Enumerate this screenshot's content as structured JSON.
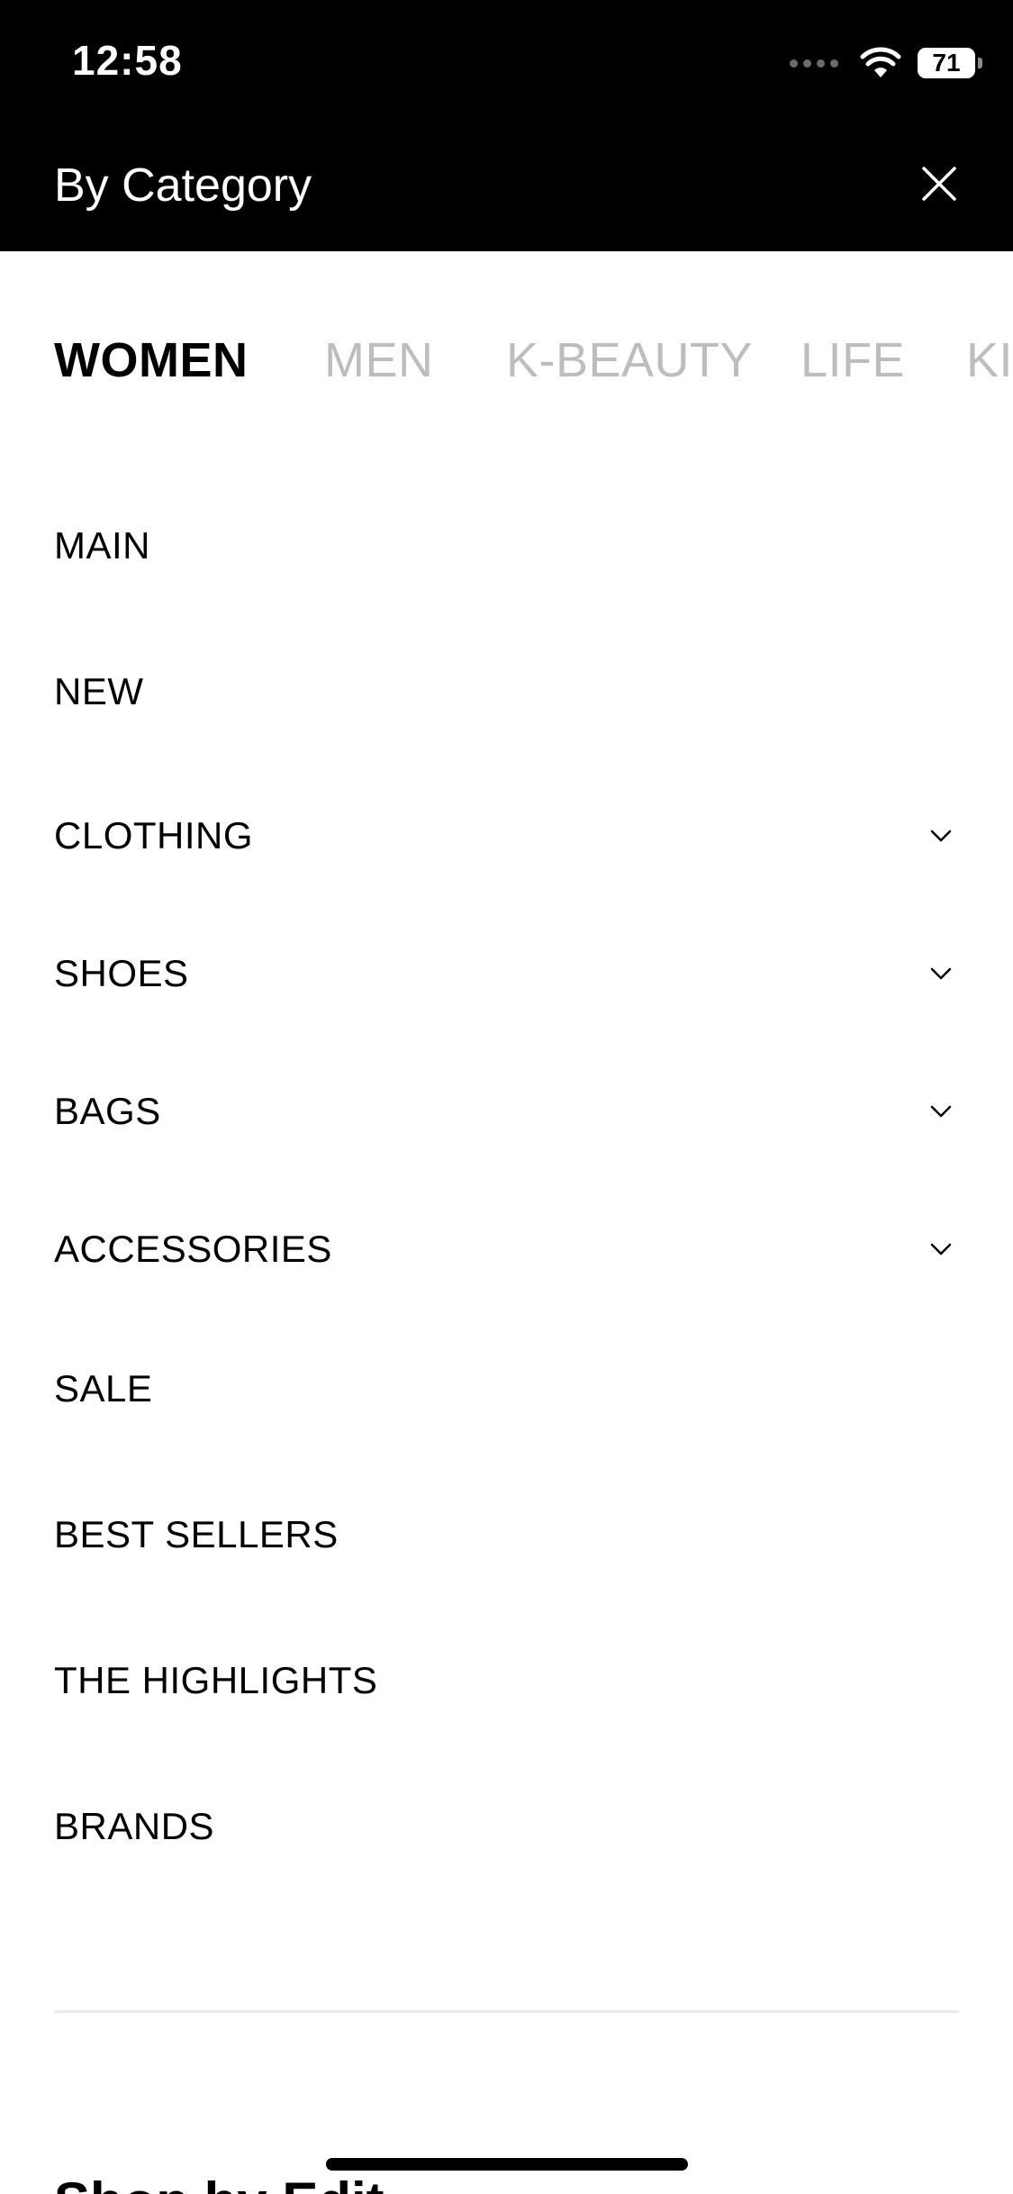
{
  "status_bar": {
    "time": "12:58",
    "battery": "71"
  },
  "header": {
    "title": "By Category",
    "close_icon": "close-icon"
  },
  "tabs": [
    {
      "label": "WOMEN",
      "active": true
    },
    {
      "label": "MEN",
      "active": false
    },
    {
      "label": "K-BEAUTY",
      "active": false
    },
    {
      "label": "LIFE",
      "active": false
    },
    {
      "label": "KIDS",
      "active": false
    }
  ],
  "menu": {
    "items": [
      {
        "label": "MAIN",
        "expandable": false
      },
      {
        "label": "NEW",
        "expandable": false
      },
      {
        "label": "CLOTHING",
        "expandable": true
      },
      {
        "label": "SHOES",
        "expandable": true
      },
      {
        "label": "BAGS",
        "expandable": true
      },
      {
        "label": "ACCESSORIES",
        "expandable": true
      },
      {
        "label": "SALE",
        "expandable": false
      },
      {
        "label": "BEST SELLERS",
        "expandable": false
      },
      {
        "label": "THE HIGHLIGHTS",
        "expandable": false
      },
      {
        "label": "BRANDS",
        "expandable": false
      }
    ]
  },
  "footer": {
    "partial_heading": "Shop by Edit"
  },
  "colors": {
    "header_bg": "#000000",
    "active_tab": "#000000",
    "inactive_tab": "#bdbdbd",
    "divider": "#ececec"
  }
}
